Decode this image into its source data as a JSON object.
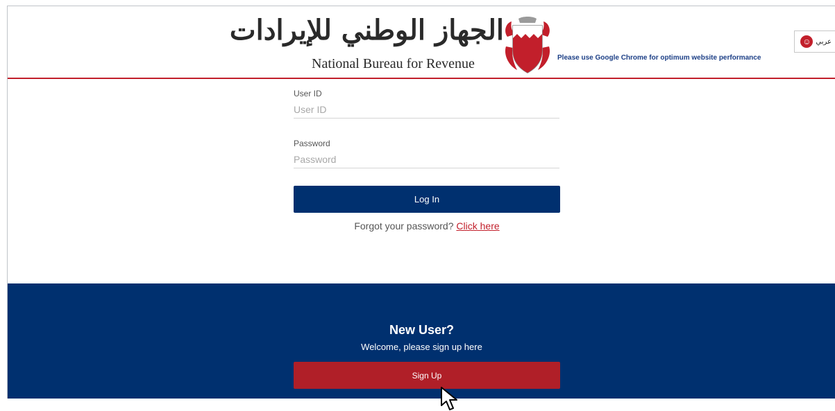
{
  "header": {
    "arabic_title": "الجهاز الوطني للإيرادات",
    "english_title": "National Bureau for Revenue",
    "browser_note": "Please use Google Chrome for optimum website performance",
    "language_label": "عربي",
    "emblem_icon": "bahrain-emblem-icon",
    "globe_icon": "globe-icon"
  },
  "login": {
    "user_id_label": "User ID",
    "user_id_value": "",
    "user_id_placeholder": "User ID",
    "password_label": "Password",
    "password_value": "",
    "password_placeholder": "Password",
    "login_label": "Log In",
    "forgot_text": "Forgot your password?",
    "forgot_link": "Click here"
  },
  "new_user": {
    "title": "New User?",
    "subtitle": "Welcome, please sign up here",
    "signup_label": "Sign Up"
  },
  "colors": {
    "navy": "#00306f",
    "red": "#c21f2b",
    "signup_red": "#b01f28",
    "note_blue": "#1c3f86"
  }
}
